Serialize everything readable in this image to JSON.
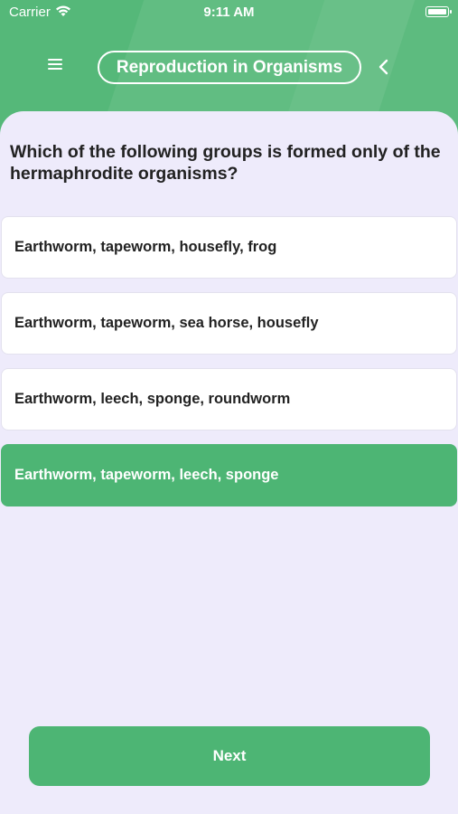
{
  "status_bar": {
    "carrier": "Carrier",
    "time": "9:11 AM"
  },
  "header": {
    "title": "Reproduction in Organisms",
    "menu_icon": "hamburger-menu-icon",
    "back_icon": "chevron-left-icon"
  },
  "question": {
    "text": "Which of the following groups is formed only of the hermaphrodite organisms?"
  },
  "options": [
    {
      "label": "Earthworm, tapeworm, housefly, frog",
      "selected": false
    },
    {
      "label": "Earthworm, tapeworm, sea horse, housefly",
      "selected": false
    },
    {
      "label": "Earthworm, leech, sponge, roundworm",
      "selected": false
    },
    {
      "label": "Earthworm, tapeworm, leech, sponge",
      "selected": true
    }
  ],
  "footer": {
    "next_label": "Next"
  },
  "colors": {
    "accent": "#4db574",
    "background": "#eeebfb",
    "text": "#222222"
  }
}
